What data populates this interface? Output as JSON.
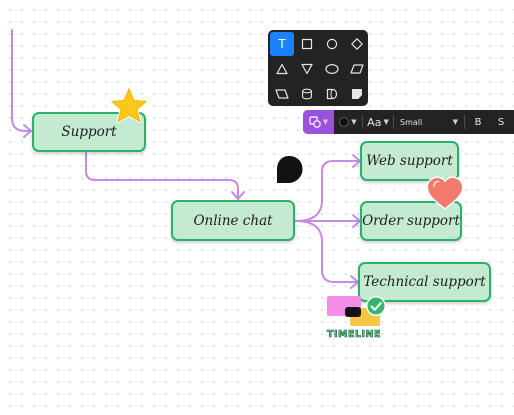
{
  "canvas": {
    "background": "#ffffff",
    "dot_color": "#d9d9d9"
  },
  "colors": {
    "node_fill": "#c5ead2",
    "node_border": "#2bb06a",
    "connector": "#c78ae3",
    "toolbar_bg": "#232323",
    "toolbar_accent": "#9b51e0",
    "active_tool": "#1b82ff"
  },
  "mindmap": {
    "nodes": {
      "support": "Support",
      "online_chat": "Online chat",
      "web_support": "Web support",
      "order_support": "Order support",
      "technical_support": "Technical support"
    }
  },
  "stickers": {
    "star": "star-sticker",
    "heart": "heart-sticker",
    "blob": "black-blob-shape",
    "timeline_text": "TIMELINE"
  },
  "shape_panel": {
    "selected_tool": "T",
    "tools": [
      "text-tool",
      "square",
      "circle",
      "diamond",
      "triangle",
      "triangle-down",
      "ellipse",
      "parallelogram",
      "parallelogram-left",
      "cylinder",
      "rounded-square",
      "document-shape"
    ]
  },
  "toolbar": {
    "shape_icon": "shapes-icon",
    "font_label": "Aa",
    "size_label": "Small",
    "bold_label": "B",
    "strike_label": "S"
  }
}
